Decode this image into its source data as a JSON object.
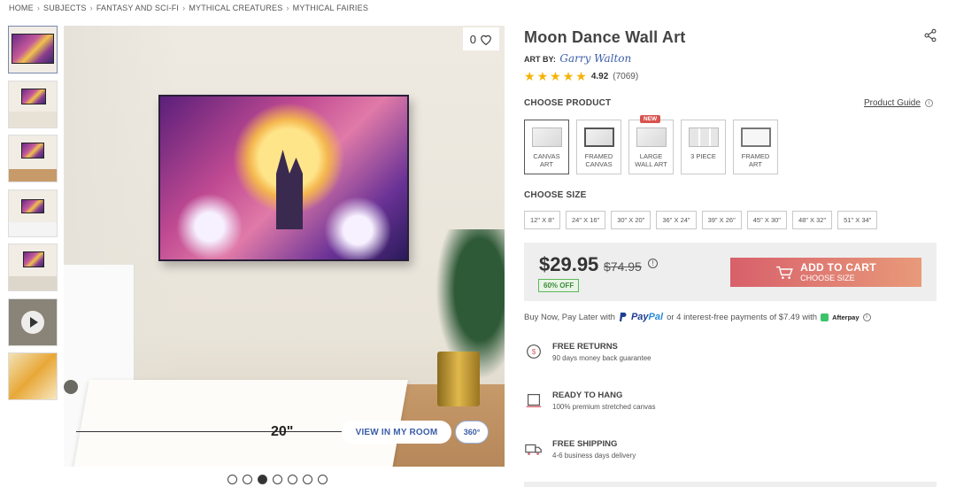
{
  "breadcrumb": [
    "HOME",
    "SUBJECTS",
    "FANTASY AND SCI-FI",
    "MYTHICAL CREATURES",
    "MYTHICAL FAIRIES"
  ],
  "gallery": {
    "favorite_count": "0",
    "size_indicator": "20\"",
    "view_in_room": "VIEW IN MY ROOM",
    "view_360": "360°",
    "carousel_total": 7,
    "carousel_active": 3
  },
  "product": {
    "title": "Moon Dance Wall Art",
    "art_by_label": "ART BY:",
    "artist": "Garry Walton",
    "rating": "4.92",
    "rating_value": 4.92,
    "review_count": "(7069)"
  },
  "choose_product": {
    "label": "CHOOSE PRODUCT",
    "guide": "Product Guide",
    "options": [
      {
        "label": "CANVAS\nART",
        "selected": true
      },
      {
        "label": "FRAMED\nCANVAS",
        "selected": false
      },
      {
        "label": "LARGE\nWALL ART",
        "badge": "NEW",
        "selected": false
      },
      {
        "label": "3 PIECE",
        "selected": false
      },
      {
        "label": "FRAMED\nART",
        "selected": false
      }
    ]
  },
  "choose_size": {
    "label": "CHOOSE SIZE",
    "sizes": [
      "12\" X 8\"",
      "24\" X 16\"",
      "30\" X 20\"",
      "36\" X 24\"",
      "39\" X 26\"",
      "45\" X 30\"",
      "48\" X 32\"",
      "51\" X 34\""
    ]
  },
  "pricing": {
    "price": "$29.95",
    "original": "$74.95",
    "discount": "60% OFF",
    "add_to_cart": "ADD TO CART",
    "choose_size": "CHOOSE SIZE"
  },
  "bnpl": {
    "prefix": "Buy Now, Pay Later with",
    "paypal_a": "Pay",
    "paypal_b": "Pal",
    "middle": "or 4 interest-free payments of $7.49 with",
    "afterpay": "Afterpay"
  },
  "features": [
    {
      "title": "FREE RETURNS",
      "desc": "90 days money back guarantee",
      "icon": "returns-icon"
    },
    {
      "title": "READY TO HANG",
      "desc": "100% premium stretched canvas",
      "icon": "frame-icon"
    },
    {
      "title": "FREE SHIPPING",
      "desc": "4-6 business days delivery",
      "icon": "shipping-icon"
    }
  ],
  "colors": {
    "accent": "#3c5ea8",
    "cart_start": "#d8606a",
    "cart_end": "#e89a7a",
    "star": "#f5b300",
    "discount_green": "#3d8a3d"
  }
}
